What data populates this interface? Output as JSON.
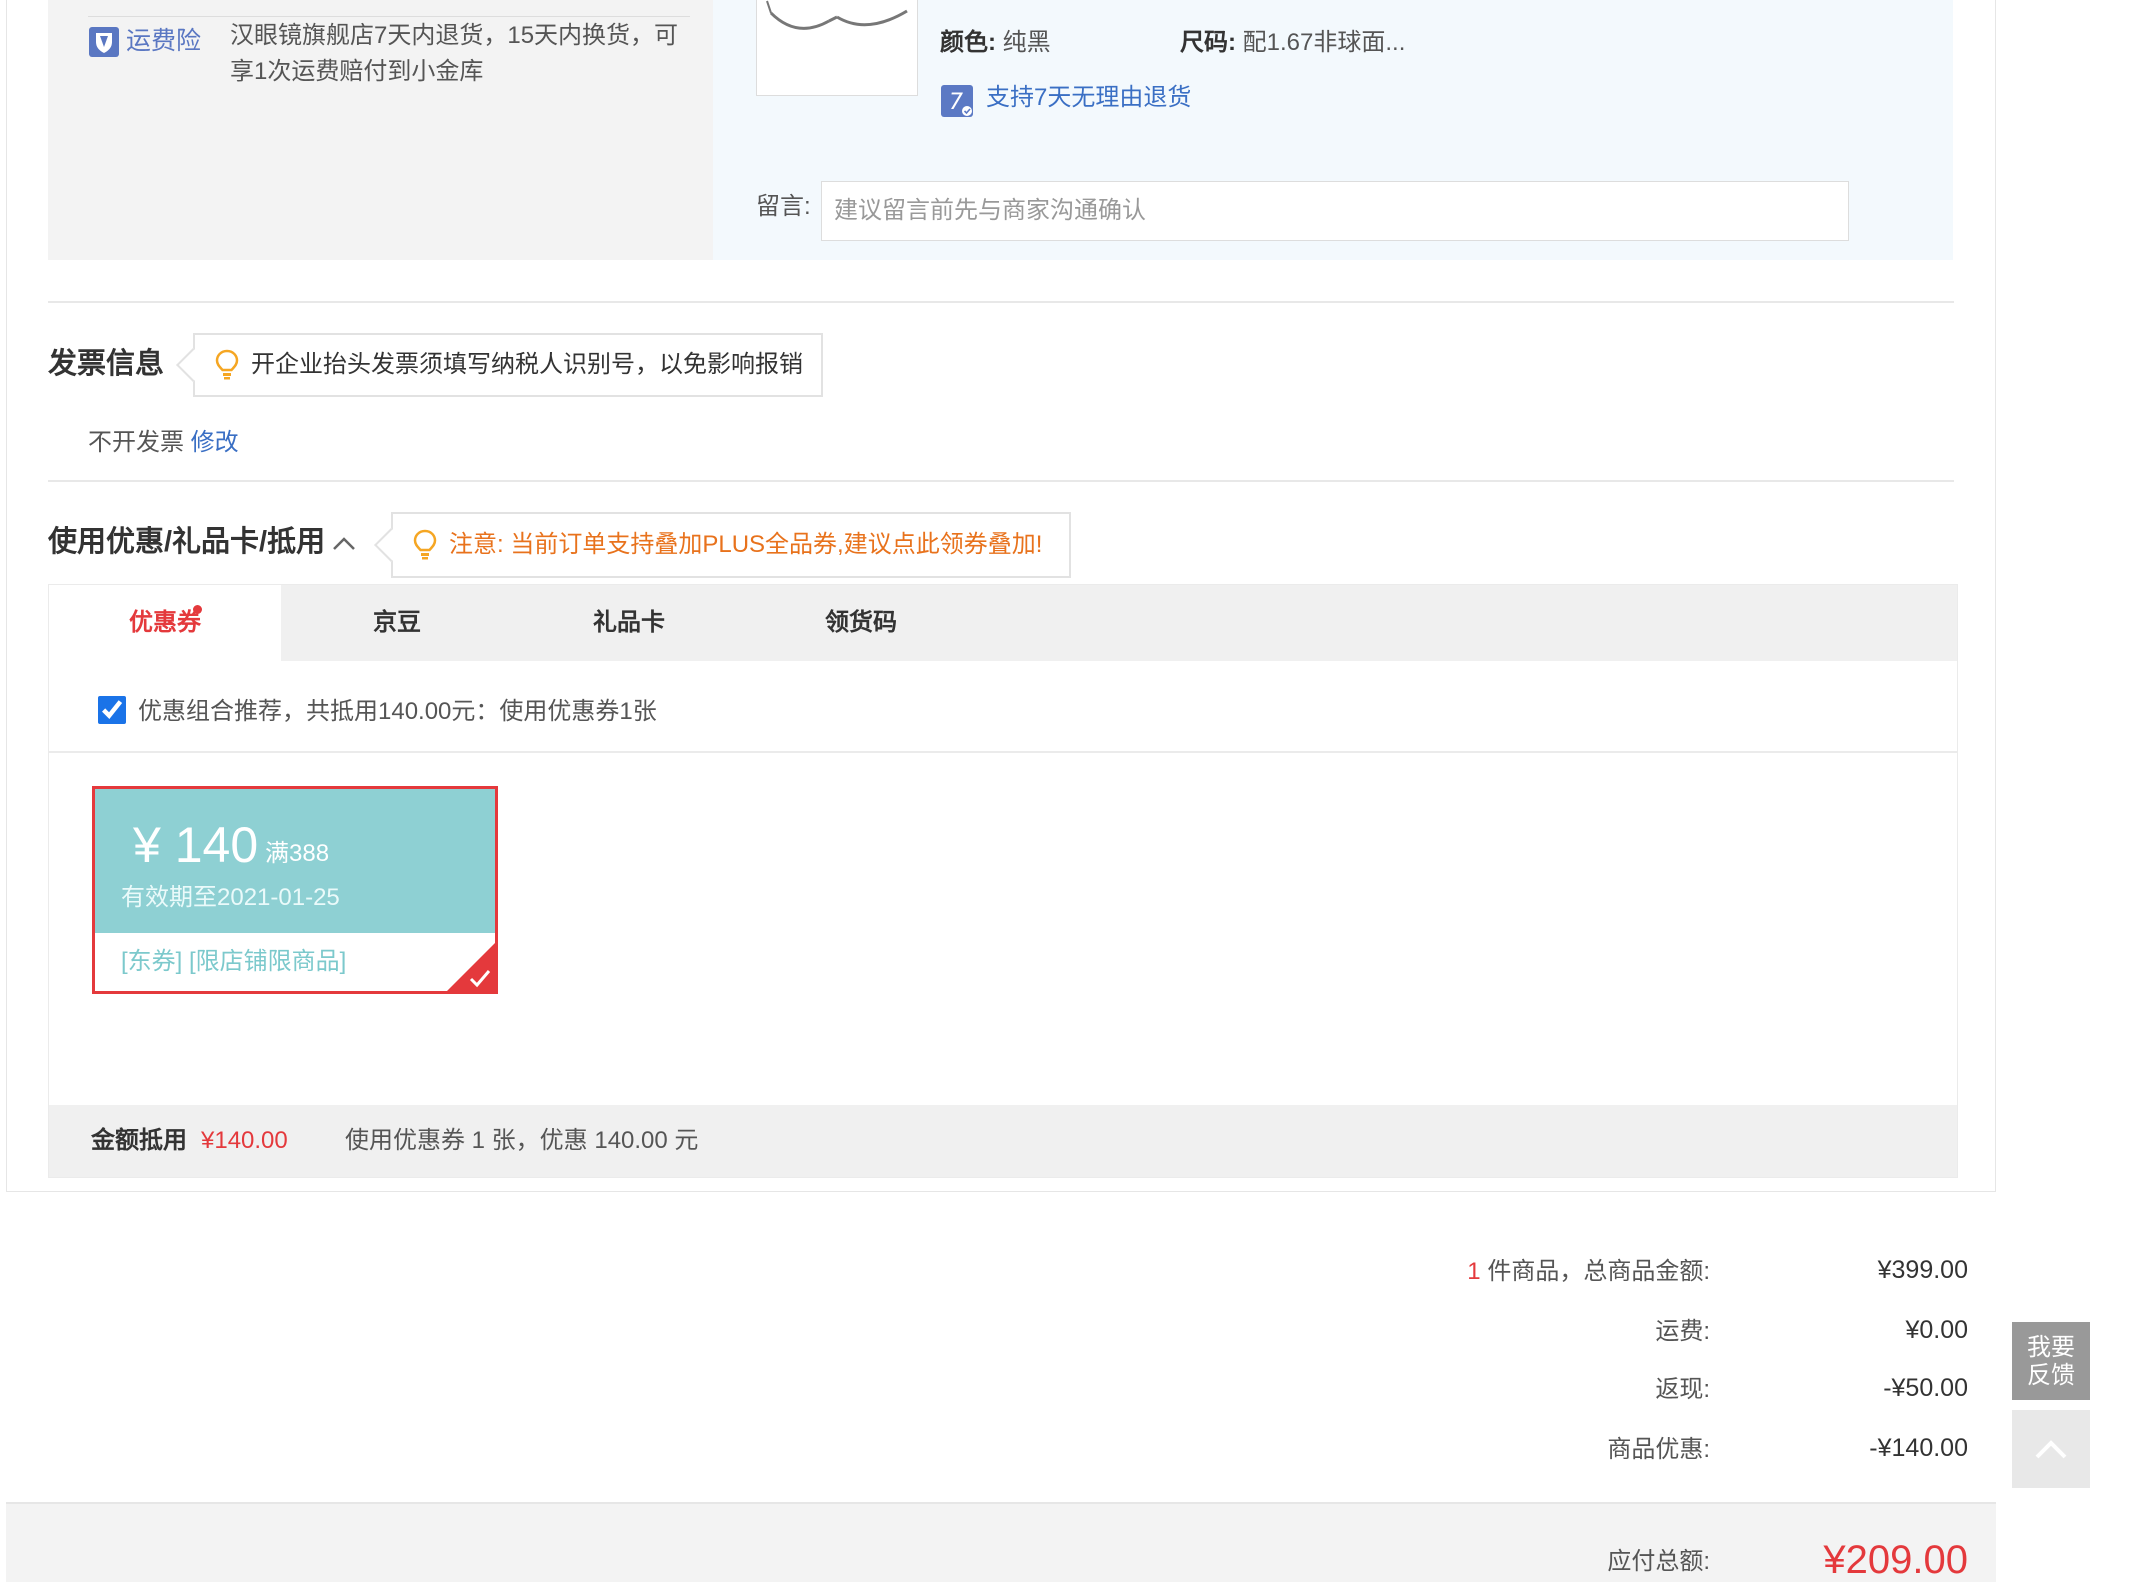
{
  "shipping_insurance": {
    "badge_label": "运费险",
    "description": "汉眼镜旗舰店7天内退货，15天内换货，可享1次运费赔付到小金库"
  },
  "product": {
    "color_label": "颜色:",
    "color_value": "纯黑",
    "size_label": "尺码:",
    "size_value": "配1.67非球面...",
    "return_policy": "支持7天无理由退货",
    "return_badge_text": "7",
    "message_label": "留言:",
    "message_placeholder": "建议留言前先与商家沟通确认"
  },
  "invoice": {
    "title": "发票信息",
    "tip": "开企业抬头发票须填写纳税人识别号，以免影响报销",
    "status": "不开发票",
    "edit_link": "修改"
  },
  "discounts": {
    "title": "使用优惠/礼品卡/抵用",
    "tip": "注意: 当前订单支持叠加PLUS全品券,建议点此领券叠加!",
    "tabs": [
      "优惠券",
      "京豆",
      "礼品卡",
      "领货码"
    ],
    "combo_checked": true,
    "combo_text": "优惠组合推荐，共抵用140.00元：使用优惠券1张",
    "coupon": {
      "amount": "¥ 140",
      "condition": "满388",
      "expiry": "有效期至2021-01-25",
      "tags": "[东券]  [限店铺限商品]",
      "selected": true
    },
    "amount_label": "金额抵用",
    "amount_value": "¥140.00",
    "amount_desc": "使用优惠券 1 张，优惠 140.00 元"
  },
  "totals": {
    "items_count": "1",
    "items_label": " 件商品，总商品金额:",
    "items_value": "¥399.00",
    "shipping_label": "运费:",
    "shipping_value": "¥0.00",
    "cashback_label": "返现:",
    "cashback_value": "-¥50.00",
    "promo_label": "商品优惠:",
    "promo_value": "-¥140.00",
    "payable_label": "应付总额:",
    "payable_value": "¥209.00"
  },
  "side_buttons": {
    "feedback_line1": "我要",
    "feedback_line2": "反馈"
  },
  "colors": {
    "accent_red": "#e4393c",
    "link_blue": "#3a6fc4",
    "tip_orange": "#e8721c",
    "coupon_teal": "#8ed0d3"
  }
}
